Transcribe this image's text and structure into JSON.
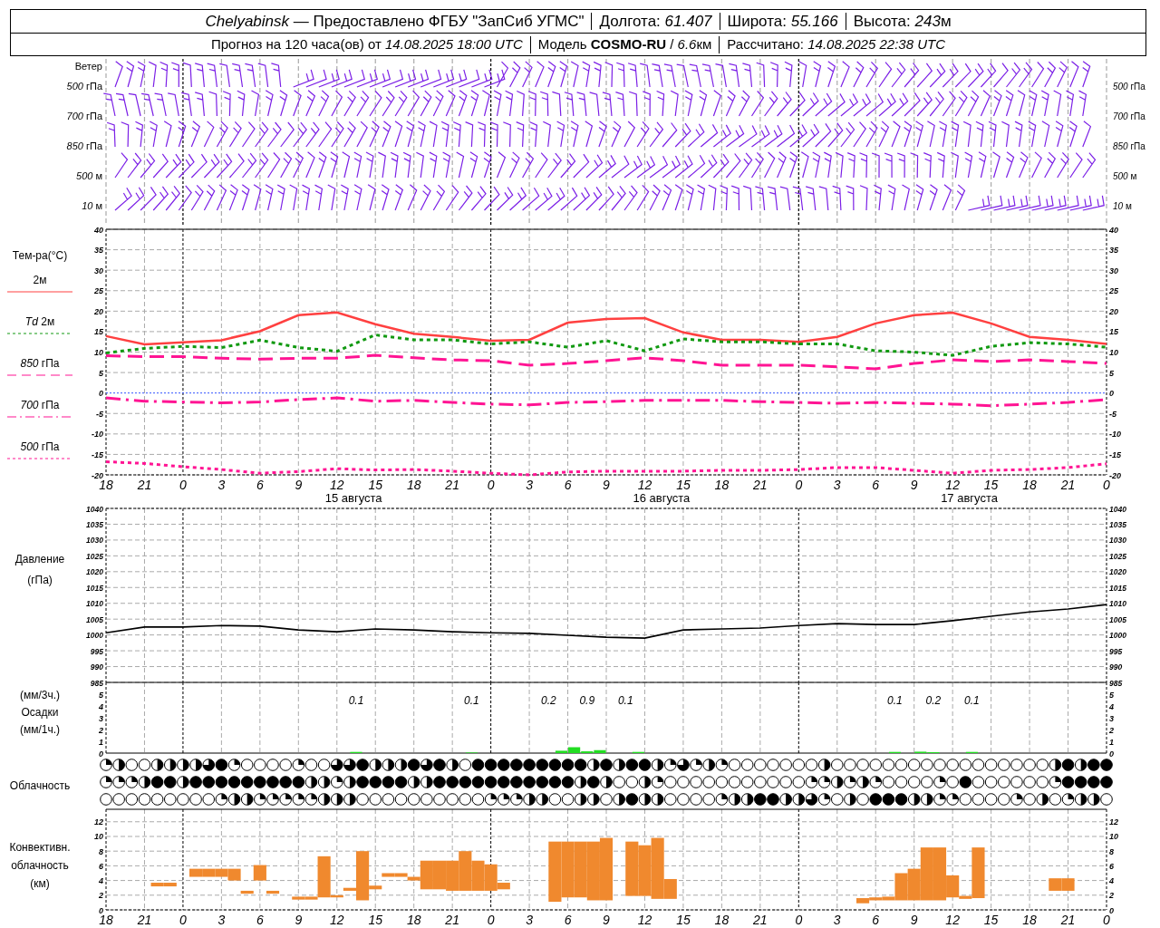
{
  "header": {
    "line_1": [
      {
        "label": "*Chelyabinsk* — Предоставлено ФГБУ \"ЗапСиб УГМС\""
      },
      {
        "label": "Долгота: *61.407*"
      },
      {
        "label": "Широта: *55.166*"
      },
      {
        "label": "Высота: *243*",
        "unit": "м"
      }
    ],
    "line_2": [
      {
        "label": "Прогноз на 120 часа(ов) от *14.08.2025 18:00 UTC*"
      },
      {
        "label": "Модель **COSMO-RU** / *6.6*",
        "unit": "км"
      },
      {
        "label": "Рассчитано: *14.08.2025 22:38 UTC*"
      }
    ]
  },
  "wind": {
    "title": "Ветер",
    "levels_left": [
      "*500* гПа",
      "*700* гПа",
      "*850* гПа",
      "*500* м",
      "*10* м"
    ],
    "levels_right": [
      "*500* гПа",
      "*700* гПа",
      "*850* гПа",
      "*500* м",
      "*10* м"
    ]
  },
  "temperature": {
    "title": "Тем-ра(°C)",
    "day_labels": [
      "15 августа",
      "16 августа",
      "17 августа"
    ],
    "right_axis_labels": [
      "40",
      "35",
      "30",
      "25",
      "20",
      "15",
      "10",
      "5",
      "0",
      "-5",
      "-10",
      "-15",
      "-20"
    ],
    "chart_data": {
      "type": "line",
      "grid": true,
      "categories": [
        "18",
        "21",
        "0",
        "3",
        "6",
        "9",
        "12",
        "15",
        "18",
        "21",
        "0",
        "3",
        "6",
        "9",
        "12",
        "15",
        "18",
        "21",
        "0",
        "3",
        "6",
        "9",
        "12",
        "15",
        "18",
        "21",
        "0"
      ],
      "ylim": [
        -20,
        40
      ],
      "yticks": [
        -20,
        -15,
        -10,
        -5,
        0,
        5,
        10,
        15,
        20,
        25,
        30,
        35,
        40
      ],
      "ref_lines": [
        {
          "axis": "y",
          "value": 0,
          "color": "#3355ff"
        }
      ],
      "series": [
        {
          "name": "2м",
          "color": "#ff4040",
          "line_style": "solid",
          "values": [
            13.9,
            11.9,
            12.4,
            12.9,
            15.1,
            19.0,
            19.7,
            16.8,
            14.5,
            13.7,
            12.8,
            13.0,
            17.2,
            18.1,
            18.3,
            14.8,
            13.0,
            13.0,
            12.5,
            13.7,
            17.0,
            19.0,
            19.6,
            17.0,
            13.7,
            13.0,
            12.0
          ]
        },
        {
          "name": "*Td*  2м",
          "color": "#119911",
          "line_style": "dotted",
          "values": [
            9.8,
            10.9,
            11.4,
            11.1,
            12.9,
            11.1,
            10.2,
            14.2,
            13.0,
            13.0,
            12.0,
            12.5,
            11.2,
            12.8,
            10.3,
            13.2,
            12.5,
            12.5,
            12.0,
            12.0,
            10.3,
            10.0,
            9.2,
            11.4,
            12.3,
            12.0,
            11.2
          ]
        },
        {
          "name": "*850* гПа",
          "color": "#ff1493",
          "line_style": "dashed",
          "values": [
            9.1,
            8.9,
            8.9,
            8.5,
            8.3,
            8.5,
            8.5,
            9.2,
            8.6,
            8.1,
            7.9,
            6.8,
            7.2,
            7.9,
            8.6,
            7.9,
            6.8,
            6.8,
            6.8,
            6.4,
            5.9,
            7.2,
            8.1,
            7.7,
            8.1,
            7.7,
            7.2
          ]
        },
        {
          "name": "*700* гПа",
          "color": "#ff1493",
          "line_style": "dashdot",
          "values": [
            -1.2,
            -2.0,
            -2.2,
            -2.4,
            -2.2,
            -1.6,
            -1.2,
            -2.0,
            -1.8,
            -2.3,
            -2.7,
            -2.9,
            -2.3,
            -2.1,
            -1.8,
            -1.8,
            -1.8,
            -2.1,
            -2.3,
            -2.5,
            -2.3,
            -2.5,
            -2.7,
            -3.1,
            -2.7,
            -2.3,
            -1.6
          ]
        },
        {
          "name": "*500* гПа",
          "color": "#ff1493",
          "line_style": "dotted",
          "values": [
            -16.8,
            -17.2,
            -18.0,
            -18.7,
            -19.6,
            -19.2,
            -18.5,
            -18.8,
            -18.7,
            -19.1,
            -19.6,
            -20.0,
            -19.3,
            -19.1,
            -19.1,
            -19.1,
            -18.9,
            -18.9,
            -18.7,
            -18.2,
            -18.2,
            -18.9,
            -19.6,
            -18.9,
            -18.7,
            -18.2,
            -17.3
          ]
        }
      ]
    }
  },
  "pressure": {
    "labels": [
      "Давление",
      "(гПа)"
    ],
    "right_axis_labels": [
      "1040",
      "1035",
      "1030",
      "1025",
      "1020",
      "1015",
      "1010",
      "1005",
      "1000",
      "995",
      "990",
      "985"
    ],
    "chart_data": {
      "type": "line",
      "grid": true,
      "ylim": [
        985,
        1040
      ],
      "yticks": [
        985,
        990,
        995,
        1000,
        1005,
        1010,
        1015,
        1020,
        1025,
        1030,
        1035,
        1040
      ],
      "categories": [
        null,
        null,
        null,
        null,
        null,
        null,
        null,
        null,
        null,
        null,
        null,
        null,
        null,
        null,
        null,
        null,
        null,
        null,
        null,
        null,
        null,
        null,
        null,
        null,
        null,
        null,
        null
      ],
      "series": [
        {
          "color": "#000000",
          "values": [
            1000.7,
            1002.5,
            1002.5,
            1003.0,
            1002.8,
            1001.6,
            1001.0,
            1001.9,
            1001.6,
            1001.0,
            1000.7,
            1000.5,
            999.9,
            999.3,
            999.0,
            1001.6,
            1001.9,
            1002.2,
            1003.0,
            1003.6,
            1003.3,
            1003.3,
            1004.5,
            1005.9,
            1007.3,
            1008.2,
            1009.6
          ]
        }
      ]
    }
  },
  "precipitation": {
    "labels": [
      "(мм/3ч.)",
      "Осадки",
      "(мм/1ч.)"
    ],
    "totals_3h": [
      "0.1",
      "0.1",
      "0.2",
      "0.9",
      "0.1",
      "0.1",
      "0.2",
      "0.1"
    ],
    "right_axis_labels": [
      "5",
      "4",
      "3",
      "2",
      "1",
      "0"
    ],
    "chart_data": {
      "type": "bar",
      "grid": true,
      "ylim": [
        0,
        6
      ],
      "yticks": [
        0,
        1,
        2,
        3,
        4,
        5
      ],
      "categories": [
        null,
        null,
        null,
        null,
        null,
        null,
        null,
        null,
        null,
        null,
        null,
        null,
        null,
        null,
        null,
        null,
        null,
        null,
        null,
        null,
        null,
        null,
        null,
        null,
        null,
        null,
        null,
        null,
        null,
        null,
        null,
        null,
        null,
        null,
        null,
        null,
        null,
        null,
        null,
        null,
        null,
        null,
        null,
        null,
        null,
        null,
        null,
        null,
        null,
        null,
        null,
        null,
        null,
        null,
        null,
        null,
        null,
        null,
        null,
        null,
        null,
        null,
        null,
        null,
        null,
        null,
        null,
        null,
        null,
        null,
        null,
        null,
        null,
        null,
        null,
        null,
        null,
        null
      ],
      "series": [
        {
          "color": "#22dd22",
          "values": [
            null,
            null,
            null,
            null,
            null,
            null,
            null,
            null,
            null,
            null,
            null,
            null,
            null,
            null,
            null,
            null,
            null,
            null,
            null,
            0.1,
            null,
            null,
            null,
            null,
            null,
            null,
            null,
            null,
            0.05,
            null,
            null,
            null,
            null,
            null,
            null,
            0.2,
            0.5,
            0.15,
            0.25,
            null,
            null,
            0.1,
            null,
            null,
            null,
            null,
            null,
            null,
            null,
            null,
            null,
            null,
            null,
            null,
            null,
            null,
            null,
            null,
            null,
            null,
            null,
            0.1,
            null,
            0.12,
            0.08,
            null,
            null,
            0.1,
            null,
            null,
            null,
            null,
            null,
            null,
            null,
            null,
            null,
            null
          ]
        }
      ]
    }
  },
  "cloudiness": {
    "title": "Облачность"
  },
  "convective_clouds": {
    "labels": [
      "Конвективн.",
      "облачность",
      "(км)"
    ],
    "right_axis_labels": [
      "12",
      "10",
      "8",
      "6",
      "4",
      "2",
      "0"
    ],
    "chart_data": {
      "type": "bar",
      "grid": true,
      "ylim": [
        0,
        13.7
      ],
      "yticks": [
        0,
        2,
        4,
        6,
        8,
        10,
        12
      ],
      "categories": [
        "18",
        null,
        null,
        "21",
        null,
        null,
        "0",
        null,
        null,
        "3",
        null,
        null,
        "6",
        null,
        null,
        "9",
        null,
        null,
        "12",
        null,
        null,
        "15",
        null,
        null,
        "18",
        null,
        null,
        "21",
        null,
        null,
        "0",
        null,
        null,
        "3",
        null,
        null,
        "6",
        null,
        null,
        "9",
        null,
        null,
        "12",
        null,
        null,
        "15",
        null,
        null,
        "18",
        null,
        null,
        "21",
        null,
        null,
        "0",
        null,
        null,
        "3",
        null,
        null,
        "6",
        null,
        null,
        "9",
        null,
        null,
        "12",
        null,
        null,
        "15",
        null,
        null,
        "18",
        null,
        null,
        "21",
        null,
        null,
        "0"
      ],
      "series": [
        {
          "color": "#f0892e",
          "base": [
            null,
            null,
            null,
            null,
            3.2,
            3.2,
            null,
            4.5,
            4.5,
            4.5,
            4.0,
            2.2,
            4.0,
            2.2,
            null,
            1.4,
            1.4,
            1.7,
            1.7,
            2.6,
            1.3,
            2.8,
            4.5,
            4.5,
            4.0,
            2.8,
            2.8,
            2.6,
            2.6,
            2.6,
            2.6,
            2.8,
            null,
            null,
            null,
            1.1,
            1.7,
            1.7,
            1.3,
            1.3,
            null,
            1.9,
            1.9,
            1.5,
            1.5,
            null,
            null,
            null,
            null,
            null,
            null,
            null,
            null,
            null,
            null,
            null,
            null,
            null,
            null,
            0.9,
            1.3,
            1.3,
            1.3,
            1.3,
            1.3,
            1.3,
            1.7,
            1.5,
            1.6,
            null,
            null,
            null,
            null,
            null,
            2.6,
            2.6,
            null,
            null,
            null
          ],
          "values": [
            null,
            null,
            null,
            null,
            0.5,
            0.5,
            null,
            1.1,
            1.1,
            1.1,
            1.6,
            0.4,
            2.1,
            0.4,
            null,
            0.4,
            0.4,
            5.6,
            0.3,
            0.4,
            6.7,
            0.5,
            0.5,
            0.5,
            0.5,
            3.9,
            3.9,
            4.1,
            5.4,
            4.1,
            3.6,
            0.9,
            null,
            null,
            null,
            8.2,
            7.6,
            7.6,
            8.0,
            8.5,
            null,
            7.4,
            6.9,
            8.3,
            2.7,
            null,
            null,
            null,
            null,
            null,
            null,
            null,
            null,
            null,
            null,
            null,
            null,
            null,
            null,
            0.7,
            0.4,
            0.5,
            3.7,
            4.3,
            7.2,
            7.2,
            3.0,
            0.4,
            6.9,
            null,
            null,
            null,
            null,
            null,
            1.7,
            1.7,
            null,
            null,
            null
          ]
        }
      ]
    }
  }
}
